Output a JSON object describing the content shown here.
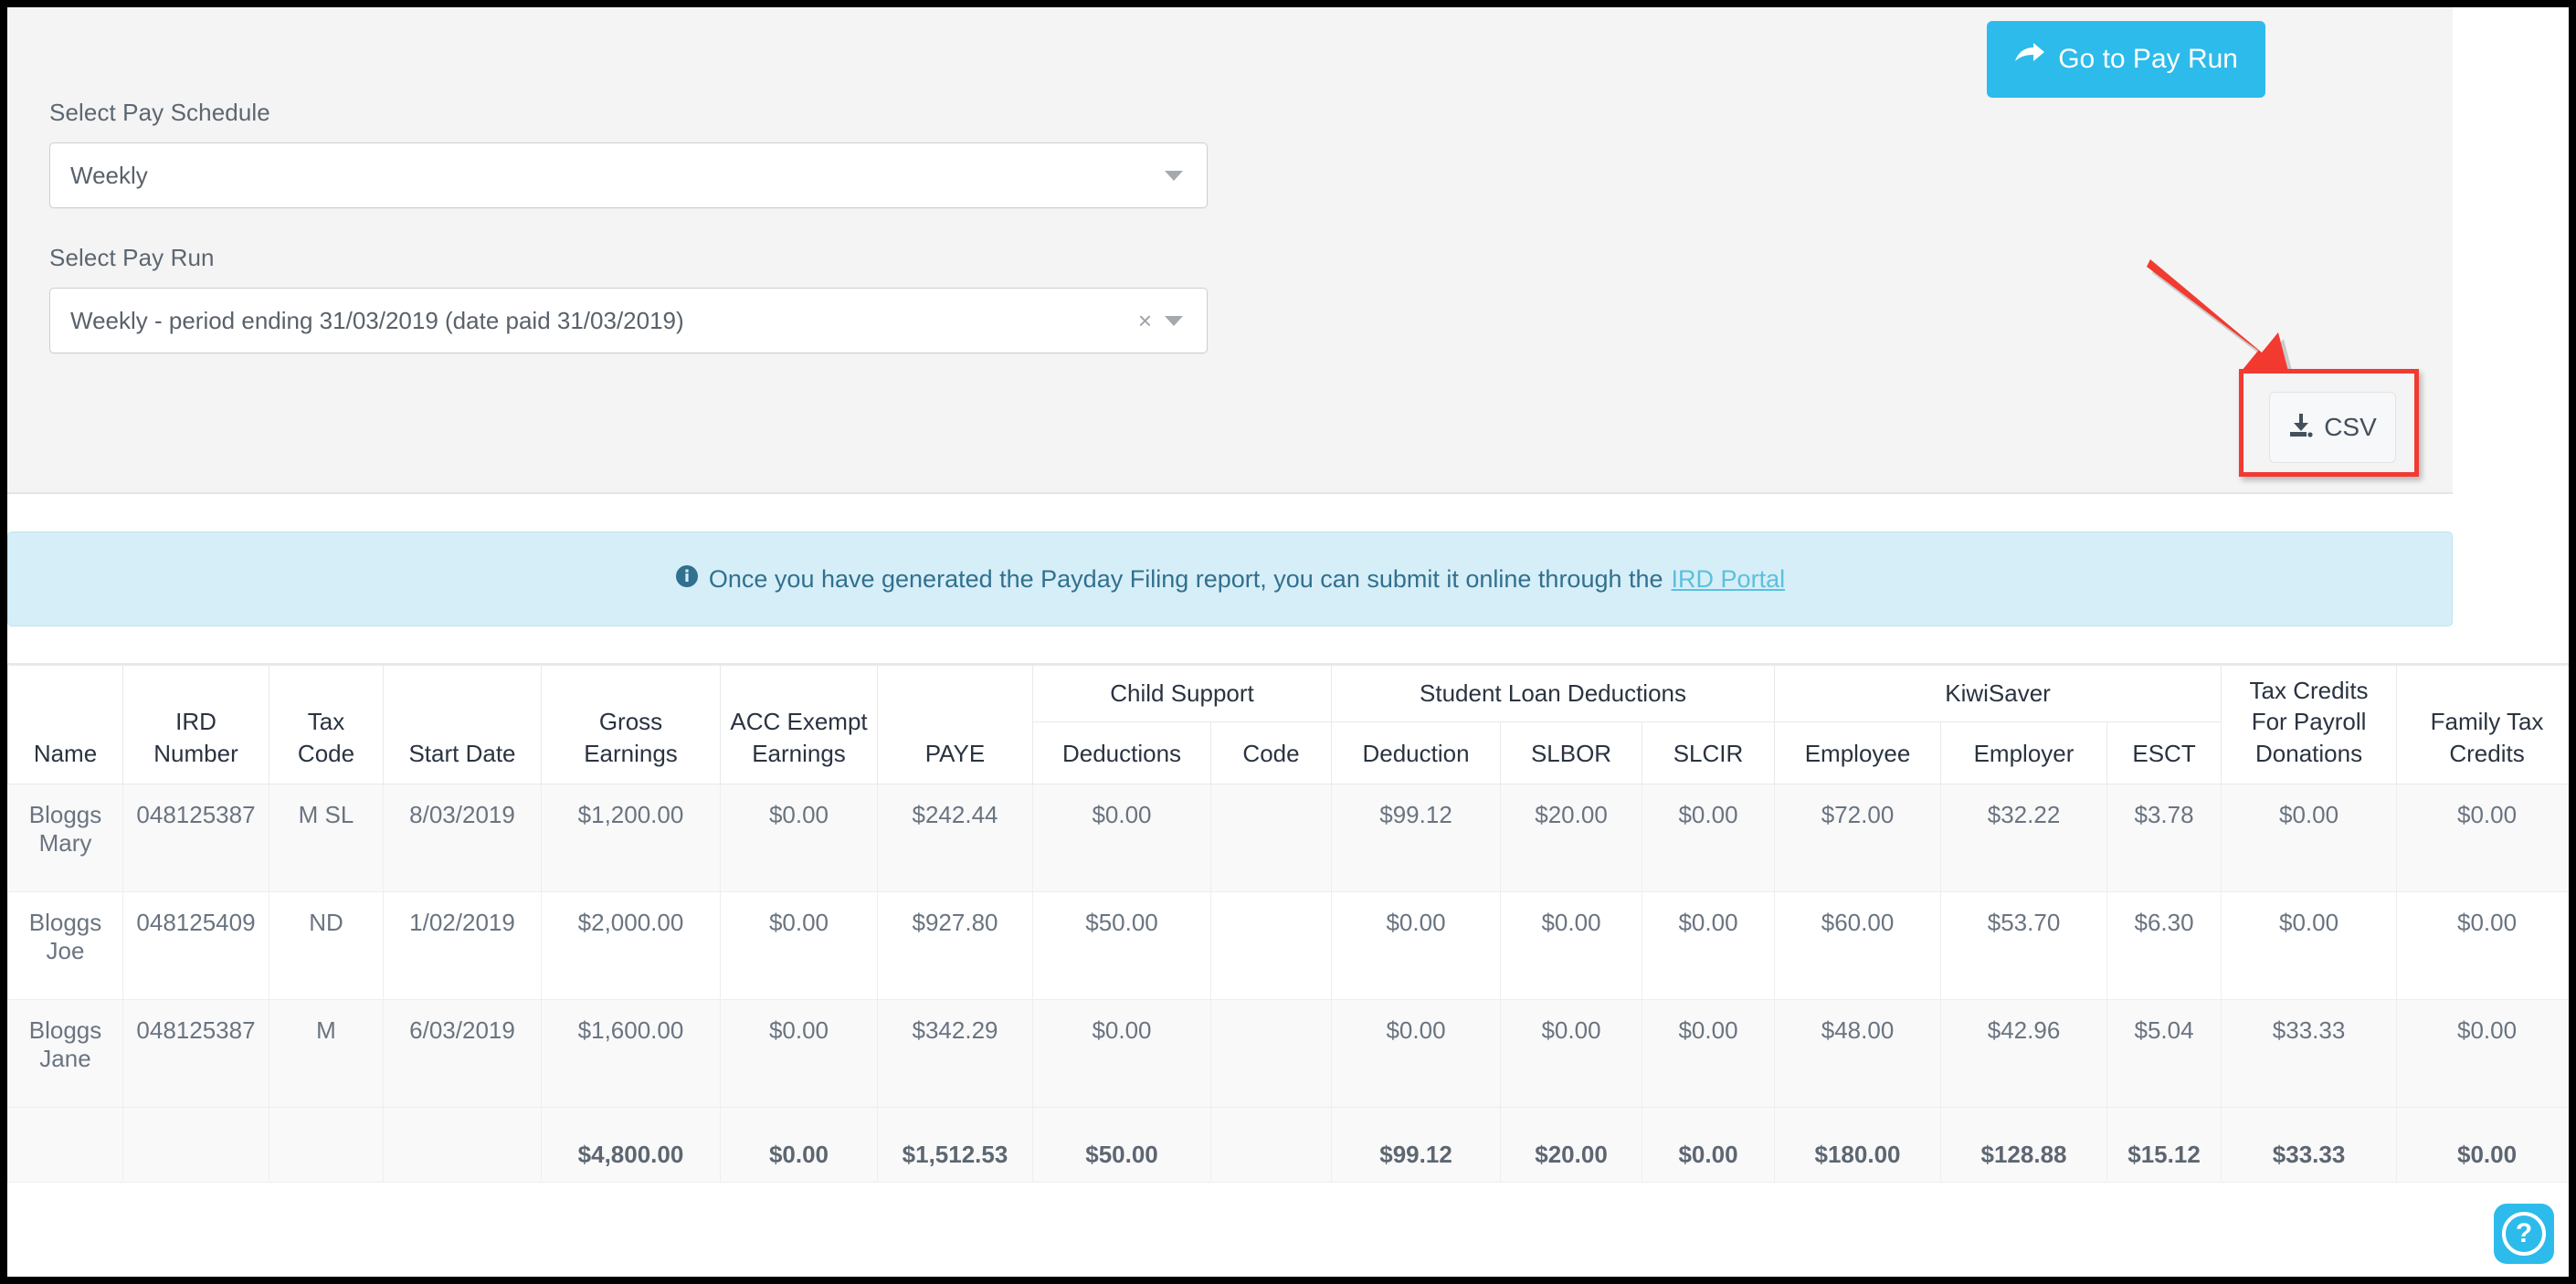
{
  "filters": {
    "schedule_label": "Select Pay Schedule",
    "schedule_value": "Weekly",
    "payrun_label": "Select Pay Run",
    "payrun_value": "Weekly - period ending 31/03/2019 (date paid 31/03/2019)",
    "clear_glyph": "×"
  },
  "toolbar": {
    "goto_payrun_label": "Go to Pay Run",
    "csv_label": "CSV",
    "accent_color": "#2dbbeb",
    "highlight_color": "#f23a30"
  },
  "banner": {
    "text": "Once you have generated the Payday Filing report, you can submit it online through the",
    "link_text": "IRD Portal",
    "bg_color": "#d6eef7",
    "text_color": "#31708f",
    "link_color": "#5bc0de"
  },
  "help": {
    "glyph": "?"
  },
  "table": {
    "group_headers": [
      {
        "label": "Child Support",
        "span": 2
      },
      {
        "label": "Student Loan Deductions",
        "span": 3
      },
      {
        "label": "KiwiSaver",
        "span": 3
      }
    ],
    "columns": [
      "Name",
      "IRD Number",
      "Tax Code",
      "Start Date",
      "Gross Earnings",
      "ACC Exempt Earnings",
      "PAYE",
      "Deductions",
      "Code",
      "Deduction",
      "SLBOR",
      "SLCIR",
      "Employee",
      "Employer",
      "ESCT",
      "Tax Credits For Payroll Donations",
      "Family Tax Credits"
    ],
    "rows": [
      {
        "name_last": "Bloggs",
        "name_first": "Mary",
        "ird": "048125387",
        "tax_code": "M SL",
        "start_date": "8/03/2019",
        "gross": "$1,200.00",
        "acc_exempt": "$0.00",
        "paye": "$242.44",
        "cs_deductions": "$0.00",
        "cs_code": "",
        "sl_deduction": "$99.12",
        "slbor": "$20.00",
        "slcir": "$0.00",
        "ks_employee": "$72.00",
        "ks_employer": "$32.22",
        "esct": "$3.78",
        "payroll_donations": "$0.00",
        "family_tax_credits": "$0.00"
      },
      {
        "name_last": "Bloggs",
        "name_first": "Joe",
        "ird": "048125409",
        "tax_code": "ND",
        "start_date": "1/02/2019",
        "gross": "$2,000.00",
        "acc_exempt": "$0.00",
        "paye": "$927.80",
        "cs_deductions": "$50.00",
        "cs_code": "",
        "sl_deduction": "$0.00",
        "slbor": "$0.00",
        "slcir": "$0.00",
        "ks_employee": "$60.00",
        "ks_employer": "$53.70",
        "esct": "$6.30",
        "payroll_donations": "$0.00",
        "family_tax_credits": "$0.00"
      },
      {
        "name_last": "Bloggs",
        "name_first": "Jane",
        "ird": "048125387",
        "tax_code": "M",
        "start_date": "6/03/2019",
        "gross": "$1,600.00",
        "acc_exempt": "$0.00",
        "paye": "$342.29",
        "cs_deductions": "$0.00",
        "cs_code": "",
        "sl_deduction": "$0.00",
        "slbor": "$0.00",
        "slcir": "$0.00",
        "ks_employee": "$48.00",
        "ks_employer": "$42.96",
        "esct": "$5.04",
        "payroll_donations": "$33.33",
        "family_tax_credits": "$0.00"
      }
    ],
    "totals": {
      "name_last": "",
      "name_first": "",
      "ird": "",
      "tax_code": "",
      "start_date": "",
      "gross": "$4,800.00",
      "acc_exempt": "$0.00",
      "paye": "$1,512.53",
      "cs_deductions": "$50.00",
      "cs_code": "",
      "sl_deduction": "$99.12",
      "slbor": "$20.00",
      "slcir": "$0.00",
      "ks_employee": "$180.00",
      "ks_employer": "$128.88",
      "esct": "$15.12",
      "payroll_donations": "$33.33",
      "family_tax_credits": "$0.00"
    }
  }
}
